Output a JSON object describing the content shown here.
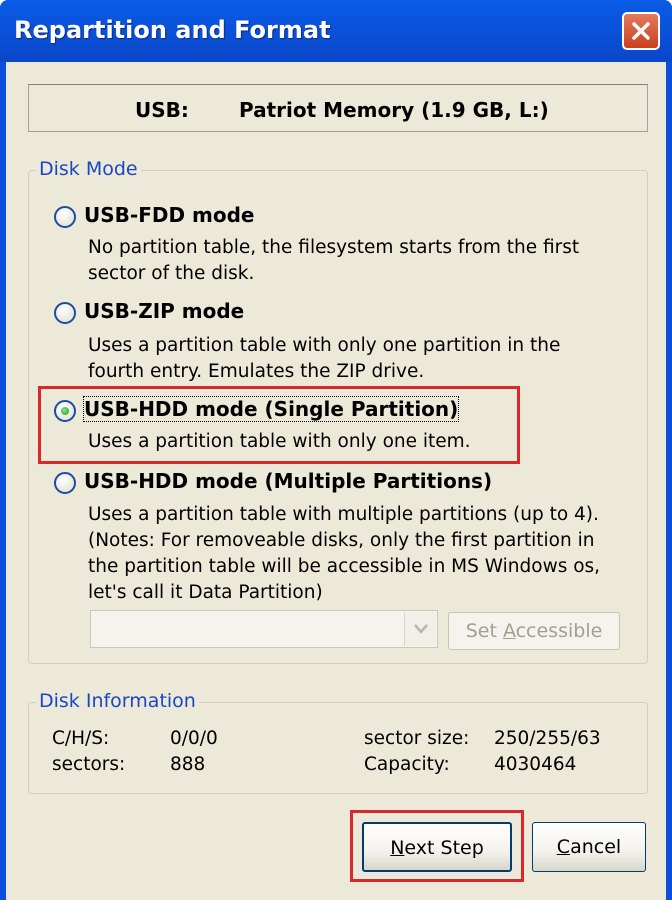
{
  "window": {
    "title": "Repartition and Format"
  },
  "usb": {
    "label": "USB:",
    "device": "Patriot Memory (1.9 GB, L:)"
  },
  "disk_mode": {
    "title": "Disk Mode",
    "options": [
      {
        "label": "USB-FDD mode",
        "selected": false,
        "desc": [
          "No partition table, the filesystem starts from the first",
          "sector of the disk."
        ]
      },
      {
        "label": "USB-ZIP mode",
        "selected": false,
        "desc": [
          "Uses a partition table with only one partition in the",
          "fourth entry. Emulates the ZIP drive."
        ]
      },
      {
        "label": "USB-HDD mode (Single Partition)",
        "selected": true,
        "desc": [
          "Uses a partition table with only one item."
        ]
      },
      {
        "label": "USB-HDD mode (Multiple Partitions)",
        "selected": false,
        "desc": [
          "Uses a partition table with multiple partitions (up to 4).",
          "(Notes: For removeable disks, only the first partition in",
          "the partition table will be accessible in MS Windows os,",
          "let's call it Data Partition)"
        ]
      }
    ],
    "partition_select": {
      "value": ""
    },
    "set_accessible": {
      "prefix": "Set ",
      "mnemonic": "A",
      "rest": "ccessible"
    }
  },
  "disk_info": {
    "title": "Disk Information",
    "chs_label": "C/H/S:",
    "chs_value": "0/0/0",
    "sectors_label": "sectors:",
    "sectors_value": "888",
    "sector_size_label": "sector size:",
    "sector_size_value": "250/255/63",
    "capacity_label": "Capacity:",
    "capacity_value": "4030464"
  },
  "buttons": {
    "next": {
      "mnemonic": "N",
      "rest": "ext Step"
    },
    "cancel": {
      "mnemonic": "C",
      "rest": "ancel"
    }
  },
  "colors": {
    "title_bar": "#0a5ce6",
    "highlight": "#d8282a",
    "dialog_bg": "#ece9d8",
    "group_title": "#1c46c8"
  },
  "icons": {
    "close": "close-icon",
    "dropdown": "chevron-down-icon"
  }
}
